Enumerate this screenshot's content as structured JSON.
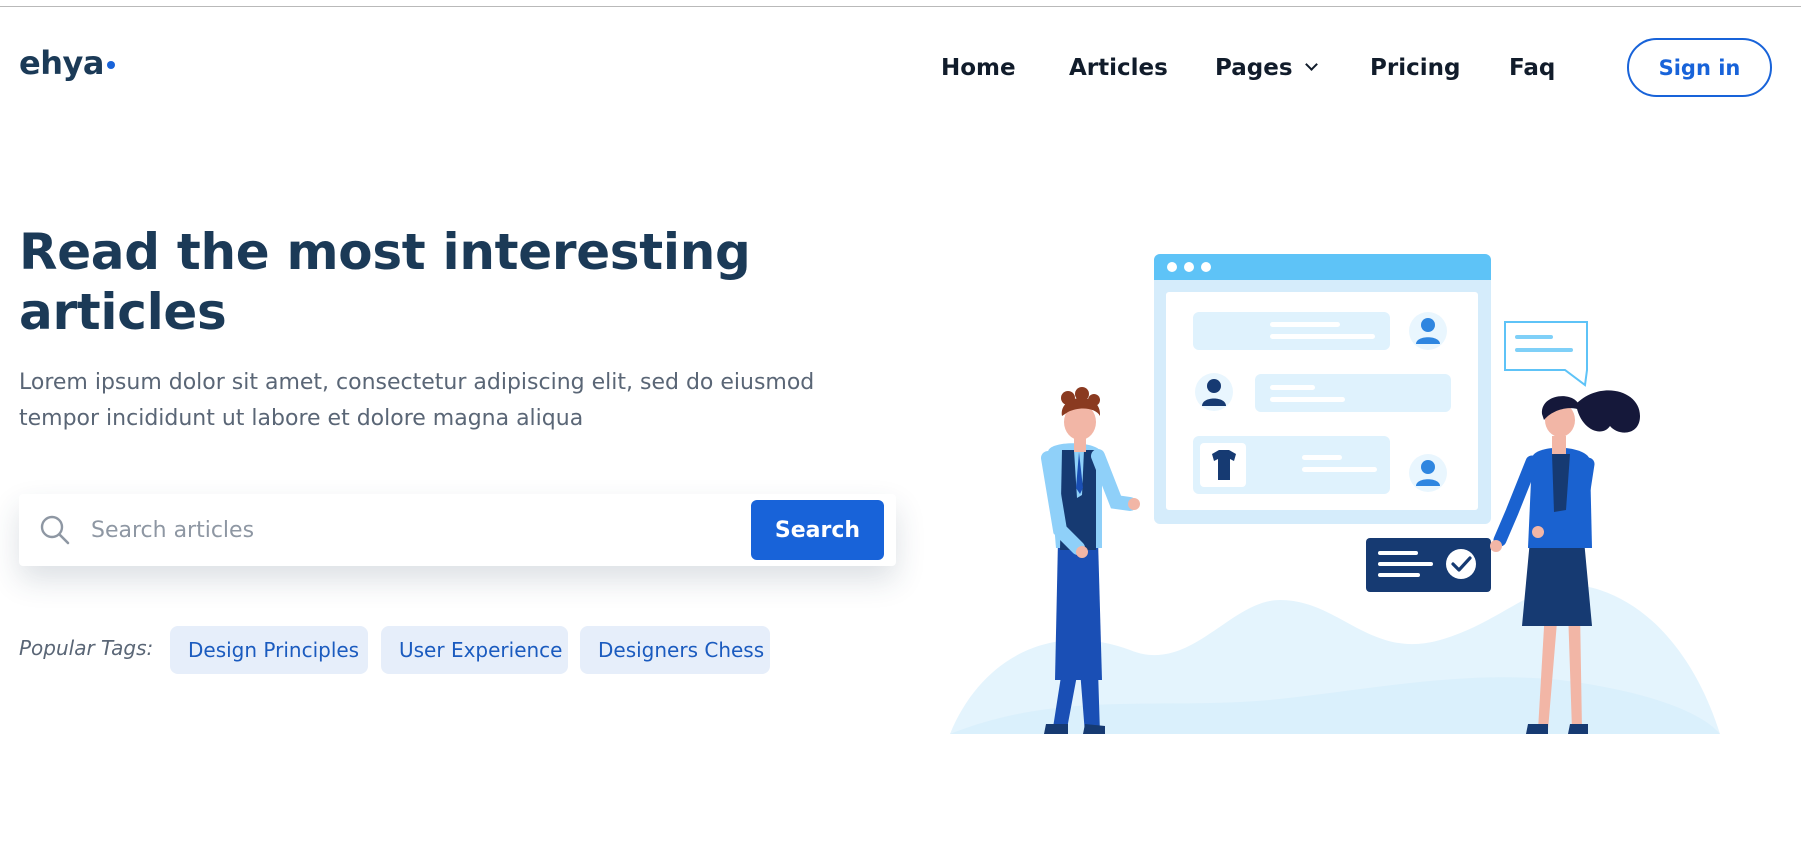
{
  "header": {
    "logo_text": "ehya",
    "nav": [
      {
        "label": "Home"
      },
      {
        "label": "Articles"
      },
      {
        "label": "Pages",
        "icon": "chevron-down-icon"
      },
      {
        "label": "Pricing"
      },
      {
        "label": "Faq"
      }
    ],
    "signin_label": "Sign in"
  },
  "hero": {
    "title": "Read the most interesting articles",
    "subtitle": "Lorem ipsum dolor sit amet, consectetur adipiscing elit, sed do eiusmod tempor incididunt ut labore et dolore magna aliqua",
    "search": {
      "placeholder": "Search articles",
      "value": "",
      "button_label": "Search",
      "icon": "search-icon"
    },
    "tags_label": "Popular Tags:",
    "tags": [
      "Design Principles",
      "User Experience",
      "Designers Chess"
    ]
  },
  "colors": {
    "primary": "#1863d9",
    "heading": "#1b3a57",
    "body_text": "#5a6676",
    "tag_bg": "#e6eefa",
    "illustration_light": "#e4f4fd",
    "illustration_sky": "#5ec3f7"
  }
}
